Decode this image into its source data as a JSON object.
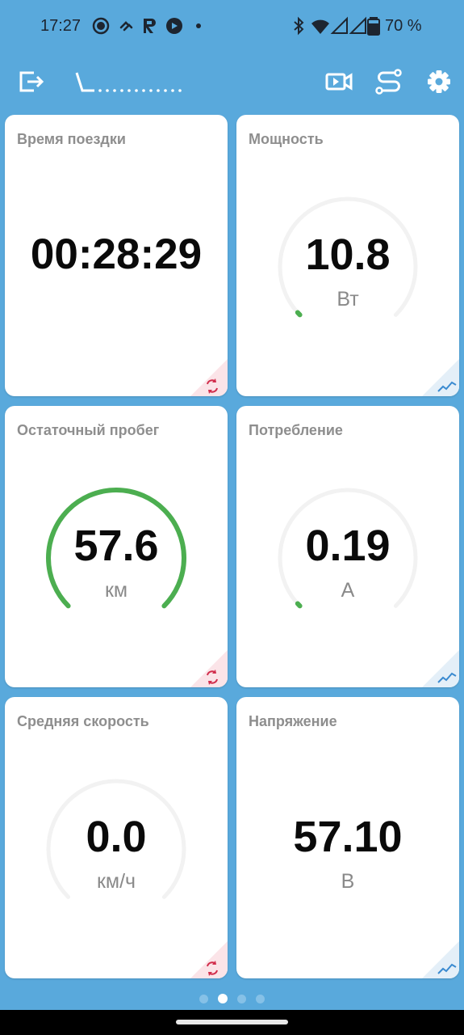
{
  "status_bar": {
    "time": "17:27",
    "battery_percent": "70 %",
    "left_icons": [
      "camera-dot-icon",
      "nfc-tag-icon",
      "app-r-icon",
      "media-icon",
      "dot-icon"
    ],
    "right_icons": [
      "bluetooth-icon",
      "wifi-icon",
      "signal-icon",
      "signal-icon",
      "battery-icon"
    ]
  },
  "toolbar": {
    "icons": [
      "exit-icon",
      "video-camera-icon",
      "route-icon",
      "gear-icon"
    ],
    "title_logo": "\\_............"
  },
  "tiles": [
    {
      "label": "Время поездки",
      "value": "00:28:29",
      "unit": "",
      "gauge": false,
      "corner": "refresh-icon",
      "corner_color": "#d12e4c"
    },
    {
      "label": "Мощность",
      "value": "10.8",
      "unit": "Вт",
      "gauge": true,
      "gauge_level": 0.01,
      "corner": "trend-chart-icon",
      "corner_color": "#3a8ad0"
    },
    {
      "label": "Остаточный пробег",
      "value": "57.6",
      "unit": "км",
      "gauge": true,
      "gauge_level": 1.0,
      "corner": "refresh-icon",
      "corner_color": "#d12e4c"
    },
    {
      "label": "Потребление",
      "value": "0.19",
      "unit": "А",
      "gauge": true,
      "gauge_level": 0.01,
      "corner": "trend-chart-icon",
      "corner_color": "#3a8ad0"
    },
    {
      "label": "Средняя скорость",
      "value": "0.0",
      "unit": "км/ч",
      "gauge": true,
      "gauge_level": 0,
      "corner": "refresh-icon",
      "corner_color": "#d12e4c"
    },
    {
      "label": "Напряжение",
      "value": "57.10",
      "unit": "В",
      "gauge": false,
      "corner": "trend-chart-icon",
      "corner_color": "#3a8ad0"
    }
  ],
  "pager": {
    "pages": 4,
    "active_index": 1
  },
  "colors": {
    "background": "#59a9dc",
    "gauge_fill": "#4cae50",
    "gauge_track": "#f2f2f2",
    "refresh_corner": "#d12e4c",
    "chart_corner": "#3a8ad0"
  }
}
